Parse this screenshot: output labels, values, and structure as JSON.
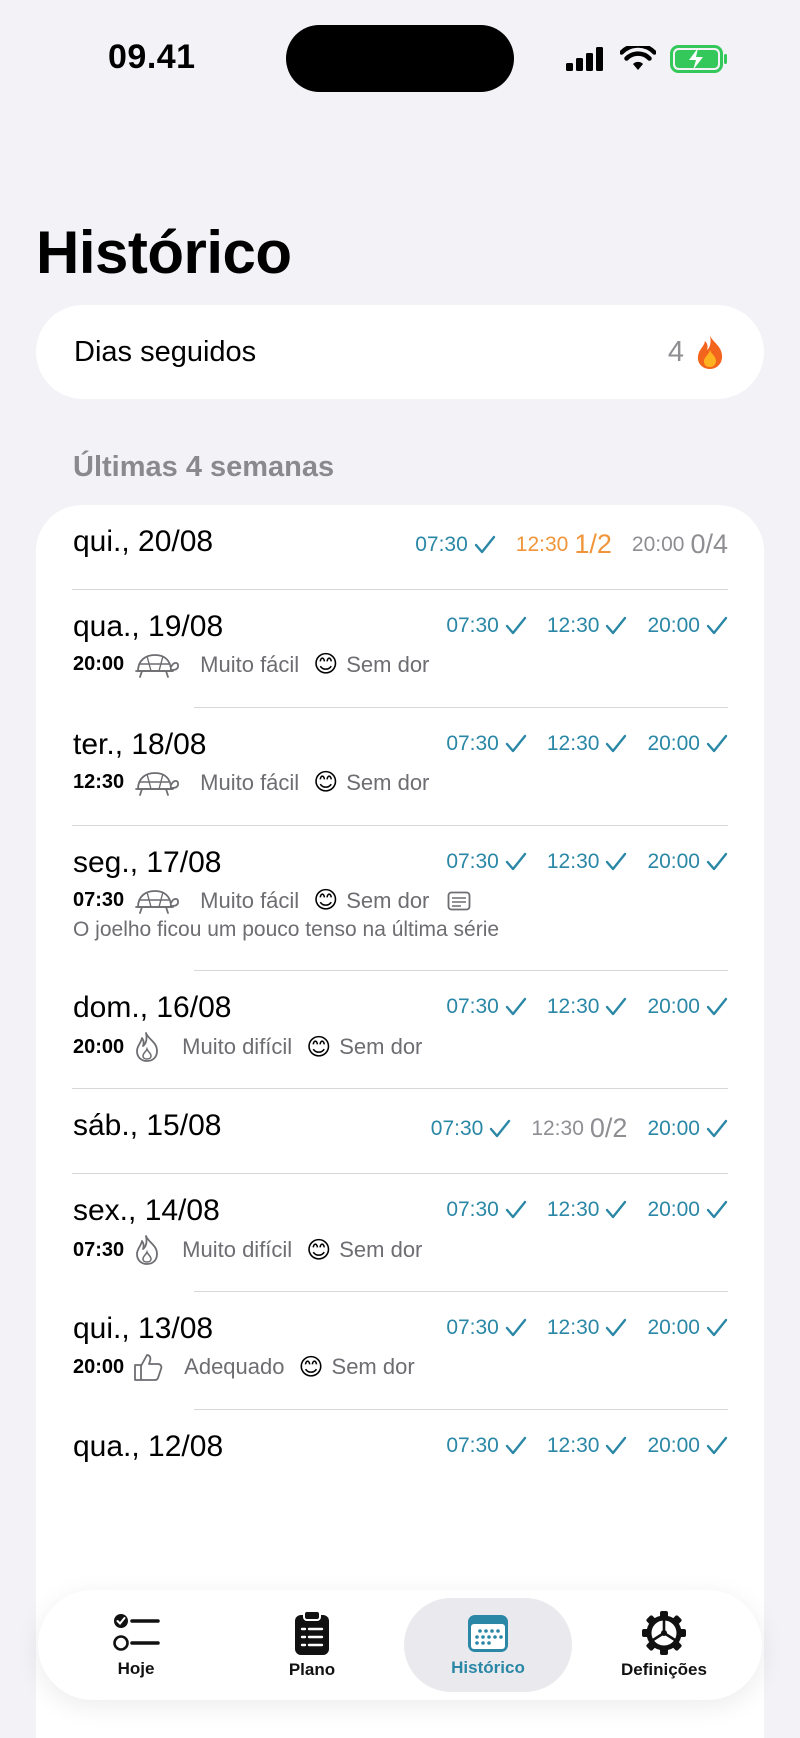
{
  "status_bar": {
    "time": "09.41"
  },
  "title": "Histórico",
  "streak": {
    "label": "Dias seguidos",
    "value": "4",
    "icon": "flame-icon"
  },
  "section_header": "Últimas 4 semanas",
  "days": [
    {
      "date": "qui., 20/08",
      "doses": [
        {
          "time": "07:30",
          "status": "done"
        },
        {
          "time": "12:30",
          "status": "partial",
          "fraction": "1/2"
        },
        {
          "time": "20:00",
          "status": "missed",
          "fraction": "0/4"
        }
      ]
    },
    {
      "date": "qua., 19/08",
      "doses": [
        {
          "time": "07:30",
          "status": "done"
        },
        {
          "time": "12:30",
          "status": "done"
        },
        {
          "time": "20:00",
          "status": "done"
        }
      ],
      "detail": {
        "time": "20:00",
        "effort_icon": "turtle-icon",
        "effort": "Muito fácil",
        "pain_emoji": "😊",
        "pain": "Sem dor"
      }
    },
    {
      "date": "ter., 18/08",
      "doses": [
        {
          "time": "07:30",
          "status": "done"
        },
        {
          "time": "12:30",
          "status": "done"
        },
        {
          "time": "20:00",
          "status": "done"
        }
      ],
      "detail": {
        "time": "12:30",
        "effort_icon": "turtle-icon",
        "effort": "Muito fácil",
        "pain_emoji": "😊",
        "pain": "Sem dor"
      }
    },
    {
      "date": "seg., 17/08",
      "doses": [
        {
          "time": "07:30",
          "status": "done"
        },
        {
          "time": "12:30",
          "status": "done"
        },
        {
          "time": "20:00",
          "status": "done"
        }
      ],
      "detail": {
        "time": "07:30",
        "effort_icon": "turtle-icon",
        "effort": "Muito fácil",
        "pain_emoji": "😊",
        "pain": "Sem dor",
        "note_icon": "note-icon"
      },
      "note": "O joelho ficou um pouco tenso na última série"
    },
    {
      "date": "dom., 16/08",
      "doses": [
        {
          "time": "07:30",
          "status": "done"
        },
        {
          "time": "12:30",
          "status": "done"
        },
        {
          "time": "20:00",
          "status": "done"
        }
      ],
      "detail": {
        "time": "20:00",
        "effort_icon": "flame-outline-icon",
        "effort": "Muito difícil",
        "pain_emoji": "😊",
        "pain": "Sem dor"
      }
    },
    {
      "date": "sáb., 15/08",
      "doses": [
        {
          "time": "07:30",
          "status": "done"
        },
        {
          "time": "12:30",
          "status": "missed",
          "fraction": "0/2"
        },
        {
          "time": "20:00",
          "status": "done"
        }
      ]
    },
    {
      "date": "sex., 14/08",
      "doses": [
        {
          "time": "07:30",
          "status": "done"
        },
        {
          "time": "12:30",
          "status": "done"
        },
        {
          "time": "20:00",
          "status": "done"
        }
      ],
      "detail": {
        "time": "07:30",
        "effort_icon": "flame-outline-icon",
        "effort": "Muito difícil",
        "pain_emoji": "😊",
        "pain": "Sem dor"
      }
    },
    {
      "date": "qui., 13/08",
      "doses": [
        {
          "time": "07:30",
          "status": "done"
        },
        {
          "time": "12:30",
          "status": "done"
        },
        {
          "time": "20:00",
          "status": "done"
        }
      ],
      "detail": {
        "time": "20:00",
        "effort_icon": "thumbs-up-icon",
        "effort": "Adequado",
        "pain_emoji": "😊",
        "pain": "Sem dor"
      }
    },
    {
      "date": "qua., 12/08",
      "doses": [
        {
          "time": "07:30",
          "status": "done"
        },
        {
          "time": "12:30",
          "status": "done"
        },
        {
          "time": "20:00",
          "status": "done"
        }
      ]
    }
  ],
  "tabs": [
    {
      "label": "Hoje",
      "icon": "checklist-icon",
      "active": false
    },
    {
      "label": "Plano",
      "icon": "clipboard-icon",
      "active": false
    },
    {
      "label": "Histórico",
      "icon": "calendar-icon",
      "active": true
    },
    {
      "label": "Definições",
      "icon": "gear-icon",
      "active": false
    }
  ],
  "colors": {
    "done": "#2a87a6",
    "partial": "#f0953a",
    "missed": "#8e8e93",
    "background": "#f2f2f7"
  }
}
